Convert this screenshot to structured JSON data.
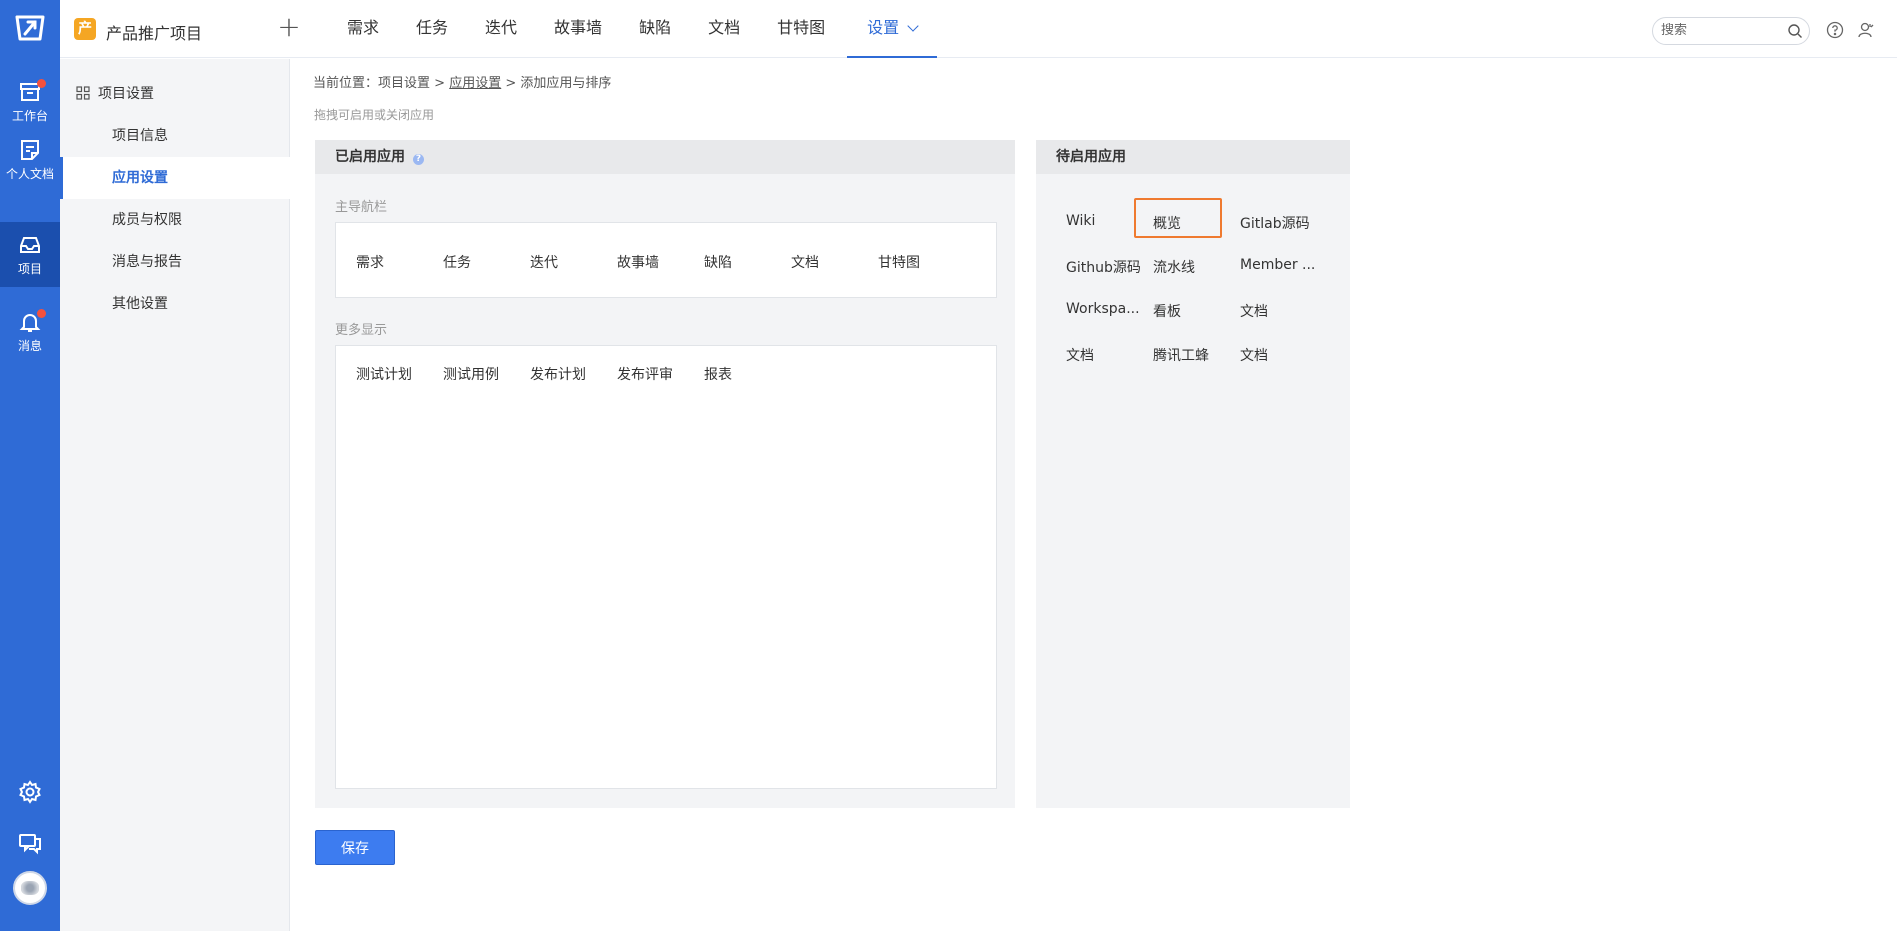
{
  "rail": {
    "items": [
      {
        "label": "工作台",
        "icon": "archive-box-icon",
        "badge": true
      },
      {
        "label": "个人文档",
        "icon": "note-icon",
        "badge": false
      },
      {
        "label": "项目",
        "icon": "inbox-icon",
        "badge": false,
        "active": true
      },
      {
        "label": "消息",
        "icon": "bell-icon",
        "badge": true
      }
    ],
    "bottom": [
      "gear-icon",
      "chat-icon",
      "avatar"
    ]
  },
  "header": {
    "project_badge": "产",
    "project_name": "产品推广项目",
    "tabs": [
      "需求",
      "任务",
      "迭代",
      "故事墙",
      "缺陷",
      "文档",
      "甘特图",
      "设置"
    ],
    "active_tab": "设置",
    "search_placeholder": "搜索"
  },
  "subnav": {
    "title": "项目设置",
    "items": [
      "项目信息",
      "应用设置",
      "成员与权限",
      "消息与报告",
      "其他设置"
    ],
    "active": "应用设置"
  },
  "breadcrumb": {
    "prefix": "当前位置：",
    "part1": "项目设置",
    "sep": ">",
    "part2": "应用设置",
    "part3": "添加应用与排序"
  },
  "hint": "拖拽可启用或关闭应用",
  "enabled_panel": {
    "title": "已启用应用",
    "main_nav_title": "主导航栏",
    "main_nav_apps": [
      "需求",
      "任务",
      "迭代",
      "故事墙",
      "缺陷",
      "文档",
      "甘特图"
    ],
    "more_title": "更多显示",
    "more_apps": [
      "测试计划",
      "测试用例",
      "发布计划",
      "发布评审",
      "报表"
    ]
  },
  "pending_panel": {
    "title": "待启用应用",
    "apps": [
      "Wiki",
      "概览",
      "Gitlab源码",
      "Github源码",
      "流水线",
      "Member ...",
      "Workspa...",
      "看板",
      "文档",
      "文档",
      "腾讯工蜂",
      "文档"
    ],
    "highlighted": "概览"
  },
  "save_label": "保存",
  "colors": {
    "primary": "#2f6bd6",
    "highlight": "#ef7a2f",
    "badge": "#f4513d"
  }
}
